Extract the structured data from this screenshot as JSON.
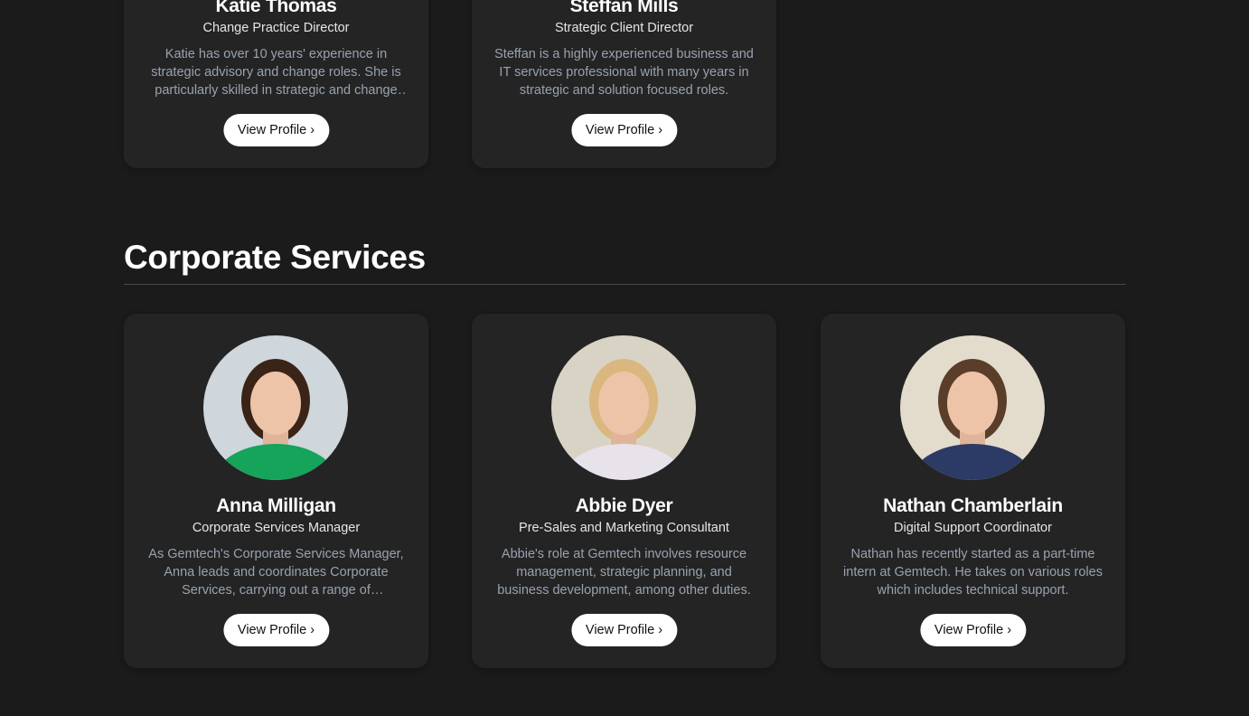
{
  "top_cards": [
    {
      "name": "Katie Thomas",
      "role": "Change Practice Director",
      "desc": "Katie has over 10 years' experience in strategic advisory and change roles. She is particularly skilled in strategic and change management.",
      "button": "View Profile ›"
    },
    {
      "name": "Steffan Mills",
      "role": "Strategic Client Director",
      "desc": "Steffan is a highly experienced business and IT services professional with many years in strategic and solution focused roles.",
      "button": "View Profile ›"
    }
  ],
  "section": {
    "title": "Corporate Services"
  },
  "cards": [
    {
      "name": "Anna Milligan",
      "role": "Corporate Services Manager",
      "desc": "As Gemtech's Corporate Services Manager, Anna leads and coordinates Corporate Services, carrying out a range of responsibilities.",
      "button": "View Profile ›",
      "bg": "#cfd6dc",
      "hair": "#3a2418",
      "shirt": "#16a35a"
    },
    {
      "name": "Abbie Dyer",
      "role": "Pre-Sales and Marketing Consultant",
      "desc": "Abbie's role at Gemtech involves resource management, strategic planning, and business development, among other duties.",
      "button": "View Profile ›",
      "bg": "#d9d3c6",
      "hair": "#d9b77e",
      "shirt": "#e8e2ea"
    },
    {
      "name": "Nathan Chamberlain",
      "role": "Digital Support Coordinator",
      "desc": "Nathan has recently started as a part-time intern at Gemtech. He takes on various roles which includes technical support.",
      "button": "View Profile ›",
      "bg": "#e3dccd",
      "hair": "#5a3e2a",
      "shirt": "#2c3a66"
    }
  ]
}
